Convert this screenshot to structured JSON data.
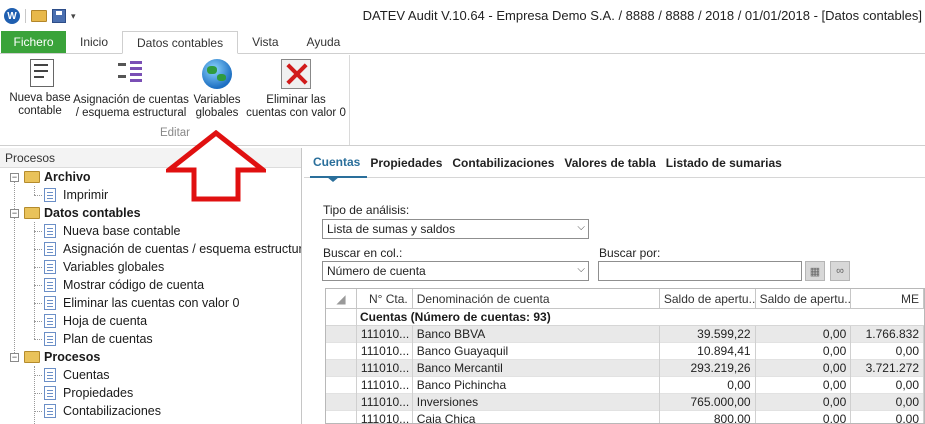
{
  "titlebar": {
    "title": "DATEV Audit V.10.64 - Empresa Demo S.A. / 8888 / 8888 / 2018 / 01/01/2018  - [Datos contables]",
    "qat_icons": [
      "datev-logo-icon",
      "open-folder-icon",
      "save-icon",
      "qat-dropdown-icon"
    ]
  },
  "ribbon": {
    "tabs": [
      "Fichero",
      "Inicio",
      "Datos contables",
      "Vista",
      "Ayuda"
    ],
    "active_tab": "Datos contables",
    "group_label": "Editar",
    "buttons": [
      {
        "label": "Nueva base contable",
        "icon": "ifrs-hgb-document-icon"
      },
      {
        "label": "Asignación de cuentas / esquema estructural",
        "icon": "account-structure-icon"
      },
      {
        "label": "Variables globales",
        "icon": "globe-icon"
      },
      {
        "label": "Eliminar las cuentas con valor 0",
        "icon": "delete-zero-accounts-icon"
      }
    ],
    "btn_lines": {
      "b0": [
        "Nueva base",
        "contable"
      ],
      "b1": [
        "Asignación de cuentas",
        "/ esquema estructural"
      ],
      "b2": [
        "Variables",
        "globales"
      ],
      "b3": [
        "Eliminar las",
        "cuentas con valor 0"
      ]
    }
  },
  "annotation": {
    "type": "up-arrow",
    "color": "#e01010"
  },
  "left_panel": {
    "header": "Procesos",
    "tree": [
      {
        "label": "Archivo",
        "type": "folder",
        "expanded": true
      },
      {
        "label": "Imprimir",
        "type": "page"
      },
      {
        "label": "Datos contables",
        "type": "folder",
        "expanded": true
      },
      {
        "label": "Nueva base contable",
        "type": "page"
      },
      {
        "label": "Asignación de cuentas / esquema estructural",
        "type": "page"
      },
      {
        "label": "Variables globales",
        "type": "page"
      },
      {
        "label": "Mostrar código de cuenta",
        "type": "page"
      },
      {
        "label": "Eliminar las cuentas con valor 0",
        "type": "page"
      },
      {
        "label": "Hoja de cuenta",
        "type": "page"
      },
      {
        "label": "Plan de cuentas",
        "type": "page"
      },
      {
        "label": "Procesos",
        "type": "folder",
        "expanded": true
      },
      {
        "label": "Cuentas",
        "type": "page"
      },
      {
        "label": "Propiedades",
        "type": "page"
      },
      {
        "label": "Contabilizaciones",
        "type": "page"
      }
    ]
  },
  "content": {
    "tabs": [
      "Cuentas",
      "Propiedades",
      "Contabilizaciones",
      "Valores de tabla",
      "Listado de sumarias"
    ],
    "active_tab": "Cuentas",
    "analysis_label": "Tipo de análisis:",
    "analysis_value": "Lista de sumas y saldos",
    "search_col_label": "Buscar en col.:",
    "search_col_value": "Número de cuenta",
    "search_by_label": "Buscar por:",
    "search_by_value": "",
    "search_tools": [
      "grid-search-icon",
      "binoculars-icon"
    ]
  },
  "grid": {
    "columns": [
      "",
      "N° Cta.",
      "Denominación de cuenta",
      "Saldo de apertu...",
      "Saldo de apertu...",
      "ME"
    ],
    "group_label": "Cuentas (Número de cuentas: 93)",
    "rows": [
      {
        "cta": "111010...",
        "name": "Banco BBVA",
        "s1": "39.599,22",
        "s2": "0,00",
        "me": "1.766.832"
      },
      {
        "cta": "111010...",
        "name": "Banco Guayaquil",
        "s1": "10.894,41",
        "s2": "0,00",
        "me": "0,00"
      },
      {
        "cta": "111010...",
        "name": "Banco Mercantil",
        "s1": "293.219,26",
        "s2": "0,00",
        "me": "3.721.272"
      },
      {
        "cta": "111010...",
        "name": "Banco Pichincha",
        "s1": "0,00",
        "s2": "0,00",
        "me": "0,00"
      },
      {
        "cta": "111010...",
        "name": "Inversiones",
        "s1": "765.000,00",
        "s2": "0,00",
        "me": "0,00"
      },
      {
        "cta": "111010...",
        "name": "Caja Chica",
        "s1": "800,00",
        "s2": "0,00",
        "me": "0,00"
      }
    ]
  }
}
